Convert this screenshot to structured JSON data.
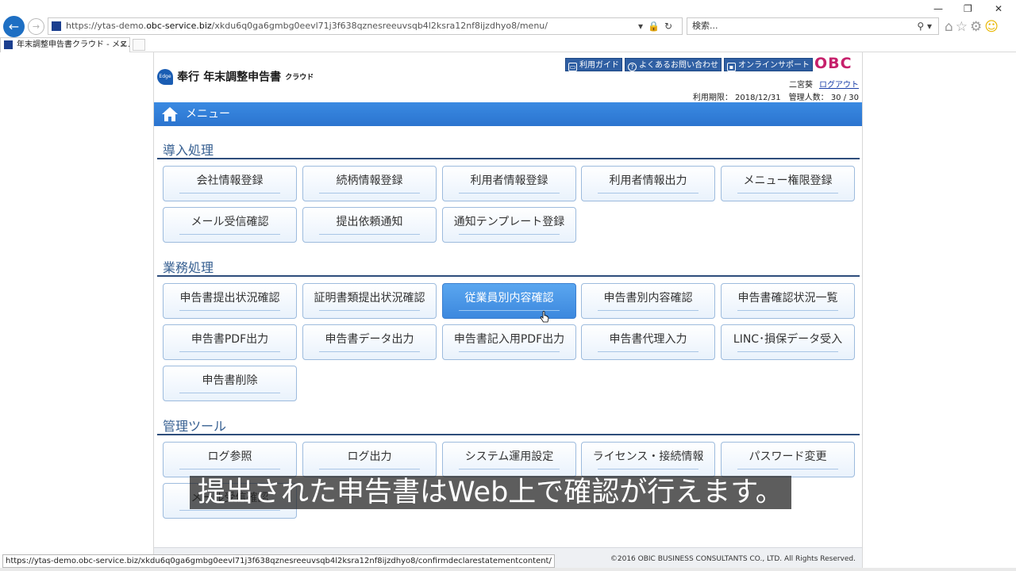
{
  "browser": {
    "url_prefix": "https://ytas-demo.",
    "url_host": "obc-service.biz",
    "url_path": "/xkdu6q0ga6gmbg0eevl71j3f638qznesreeuvsqb4l2ksra12nf8ijzdhyo8/menu/",
    "search_placeholder": "検索...",
    "tab_title": "年末調整申告書クラウド - メニ...",
    "status_url": "https://ytas-demo.obc-service.biz/xkdu6q0ga6gmbg0eevl71j3f638qznesreeuvsqb4l2ksra12nf8ijzdhyo8/confirmdeclarestatementcontent/"
  },
  "header": {
    "logo_prefix": "奉行",
    "logo_main": "年末調整申告書",
    "logo_suffix": "クラウド",
    "logo_badge": "Edge",
    "buttons": [
      "利用ガイド",
      "よくあるお問い合わせ",
      "オンラインサポート"
    ],
    "brand": "OBC",
    "user_name": "二宮葵",
    "logout": "ログアウト",
    "period_line": "利用期限： 2018/12/31　管理人数： 30 / 30"
  },
  "menubar": {
    "title": "メニュー"
  },
  "sections": [
    {
      "title": "導入処理",
      "items": [
        "会社情報登録",
        "続柄情報登録",
        "利用者情報登録",
        "利用者情報出力",
        "メニュー権限登録",
        "メール受信確認",
        "提出依頼通知",
        "通知テンプレート登録"
      ]
    },
    {
      "title": "業務処理",
      "items": [
        "申告書提出状況確認",
        "証明書類提出状況確認",
        "従業員別内容確認",
        "申告書別内容確認",
        "申告書確認状況一覧",
        "申告書PDF出力",
        "申告書データ出力",
        "申告書記入用PDF出力",
        "申告書代理入力",
        "LINC･損保データ受入",
        "申告書削除"
      ]
    },
    {
      "title": "管理ツール",
      "items": [
        "ログ参照",
        "ログ出力",
        "システム運用設定",
        "ライセンス・接続情報",
        "パスワード変更",
        "メール受信確認"
      ]
    }
  ],
  "active_item": "従業員別内容確認",
  "footer": {
    "copyright": "©2016 OBIC BUSINESS CONSULTANTS CO., LTD. All Rights Reserved."
  },
  "caption": "提出された申告書はWeb上で確認が行えます。",
  "colors": {
    "menubar": "#2b74cf",
    "active_button": "#3c88de",
    "section_title": "#365f91",
    "brand": "#c6206b"
  }
}
